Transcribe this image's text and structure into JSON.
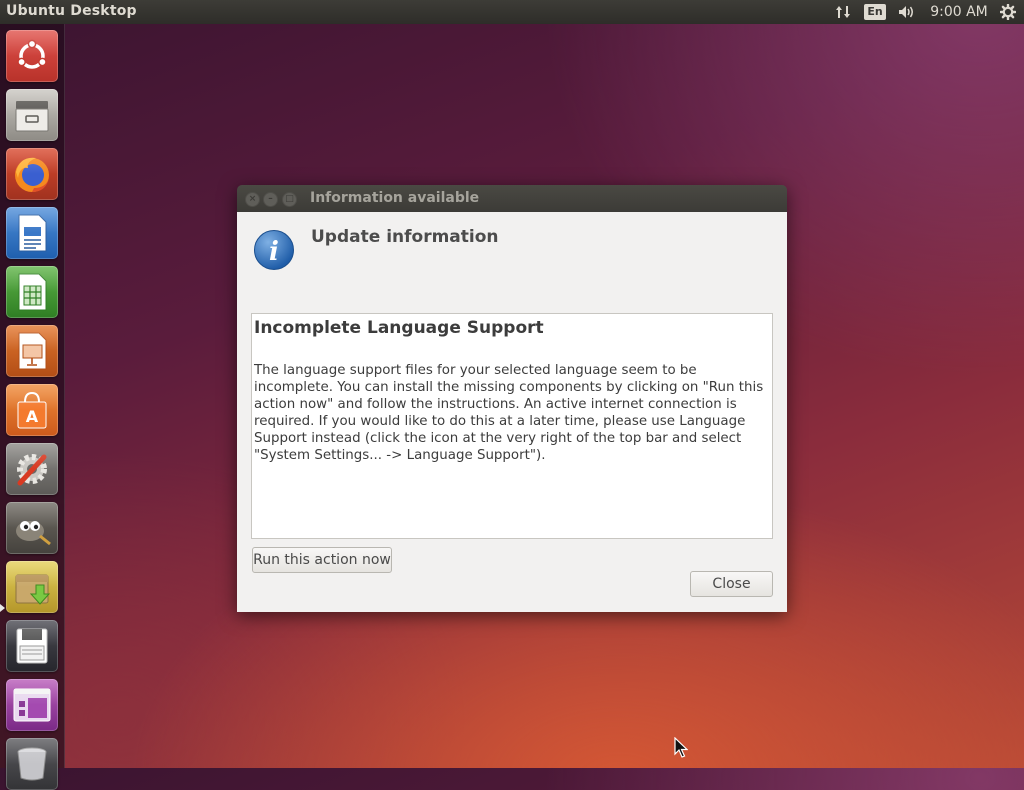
{
  "topbar": {
    "title": "Ubuntu Desktop",
    "language": "En",
    "clock": "9:00 AM"
  },
  "launcher": {
    "items": [
      {
        "name": "ubuntu-dash",
        "icon": "ubuntu-logo-icon"
      },
      {
        "name": "files",
        "icon": "file-cabinet-icon"
      },
      {
        "name": "firefox",
        "icon": "firefox-icon"
      },
      {
        "name": "libreoffice-writer",
        "icon": "writer-document-icon"
      },
      {
        "name": "libreoffice-calc",
        "icon": "calc-spreadsheet-icon"
      },
      {
        "name": "libreoffice-impress",
        "icon": "impress-presentation-icon"
      },
      {
        "name": "ubuntu-software",
        "icon": "software-bag-icon"
      },
      {
        "name": "system-settings",
        "icon": "gear-wrench-icon"
      },
      {
        "name": "gimp",
        "icon": "gimp-icon"
      },
      {
        "name": "software-updater",
        "icon": "package-download-icon",
        "active": true
      },
      {
        "name": "floppy",
        "icon": "floppy-disk-icon"
      },
      {
        "name": "workspace-switcher",
        "icon": "window-icon"
      },
      {
        "name": "trash",
        "icon": "trash-icon"
      }
    ]
  },
  "dialog": {
    "window_title": "Information available",
    "heading": "Update information",
    "message_title": "Incomplete Language Support",
    "message_body": "The language support files for your selected language seem to be incomplete. You can install the missing components by clicking on \"Run this action now\" and follow the instructions. An active internet connection is required. If you would like to do this at a later time, please use Language Support instead (click the icon at the very right of the top bar and select \"System Settings... -> Language Support\").",
    "run_button": "Run this action now",
    "close_button": "Close"
  },
  "colors": {
    "topbar_bg": "#3c3b37",
    "dialog_bg": "#f2f1f0",
    "wallpaper_orange": "#d45a36",
    "wallpaper_purple": "#5a1c3c"
  }
}
